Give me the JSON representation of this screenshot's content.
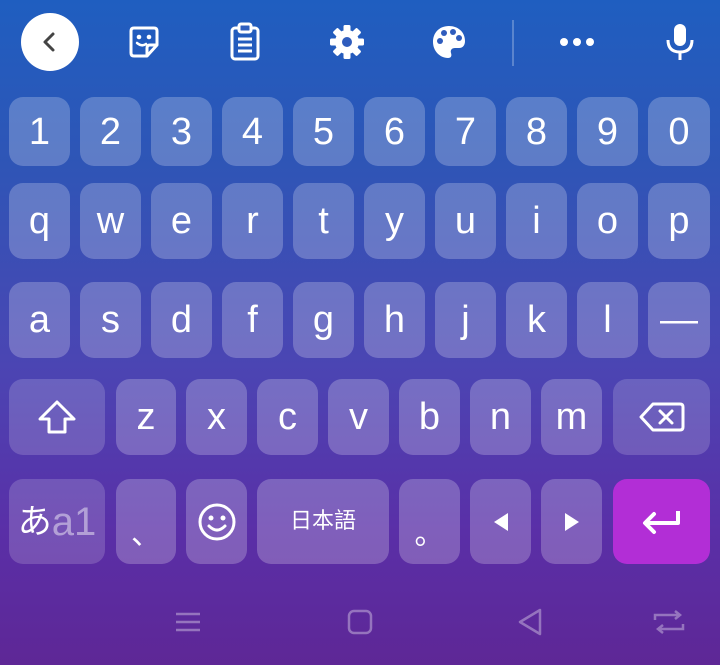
{
  "toolbar": {
    "icons": [
      "back-icon",
      "sticker-icon",
      "clipboard-icon",
      "settings-icon",
      "theme-palette-icon",
      "more-icon",
      "microphone-icon"
    ]
  },
  "keyboard": {
    "number_row": [
      "1",
      "2",
      "3",
      "4",
      "5",
      "6",
      "7",
      "8",
      "9",
      "0"
    ],
    "row1": [
      "q",
      "w",
      "e",
      "r",
      "t",
      "y",
      "u",
      "i",
      "o",
      "p"
    ],
    "row2": [
      "a",
      "s",
      "d",
      "f",
      "g",
      "h",
      "j",
      "k",
      "l",
      "—"
    ],
    "row3": [
      "z",
      "x",
      "c",
      "v",
      "b",
      "n",
      "m"
    ],
    "mode_switch": {
      "primary": "あ",
      "secondary": "a1"
    },
    "comma": "、",
    "space_label": "日本語",
    "period": "。"
  },
  "colors": {
    "enter_key": "#b22ed6",
    "background_top": "#1f5ec0",
    "background_bottom": "#5e2796"
  }
}
